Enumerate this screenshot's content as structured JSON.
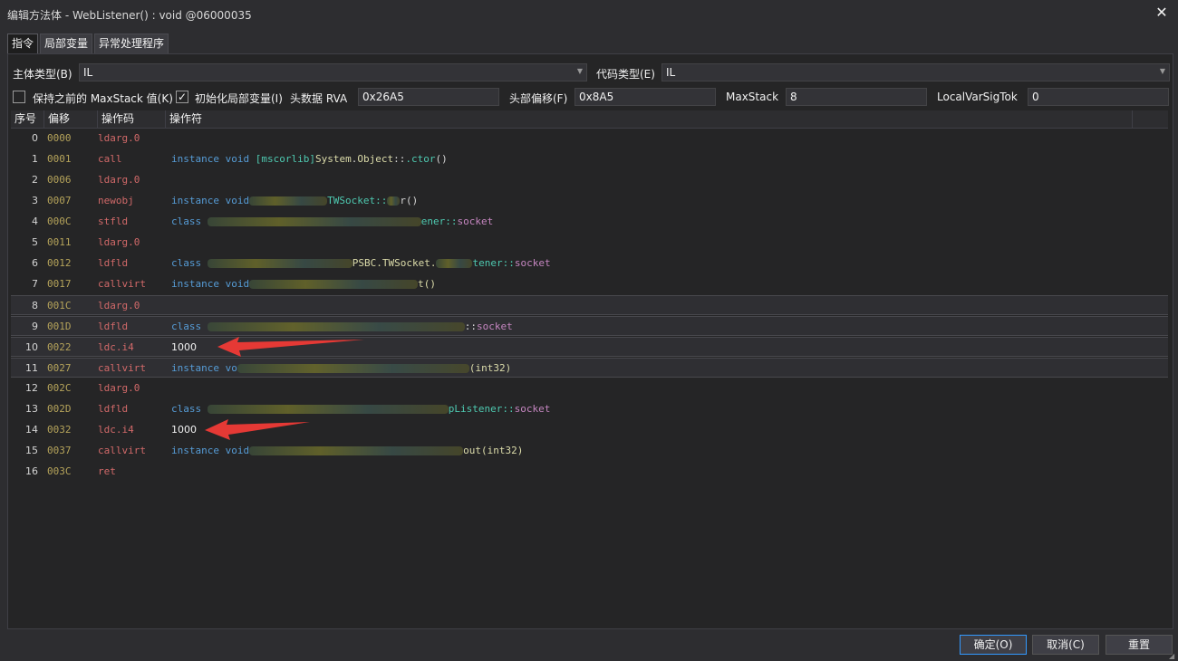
{
  "window": {
    "title": "编辑方法体 - WebListener() : void @06000035",
    "close": "✕"
  },
  "tabs": [
    "指令",
    "局部变量",
    "异常处理程序"
  ],
  "header": {
    "body_type_label": "主体类型(B)",
    "body_type_value": "IL",
    "code_type_label": "代码类型(E)",
    "code_type_value": "IL",
    "keep_maxstack_label": "保持之前的 MaxStack 值(K)",
    "keep_maxstack_checked": false,
    "init_locals_label": "初始化局部变量(I)",
    "init_locals_checked": true,
    "header_rva_label": "头数据 RVA",
    "header_rva_value": "0x26A5",
    "header_offset_label": "头部偏移(F)",
    "header_offset_value": "0x8A5",
    "maxstack_label": "MaxStack",
    "maxstack_value": "8",
    "localvarsig_label": "LocalVarSigTok",
    "localvarsig_value": "0"
  },
  "grid": {
    "columns": [
      "序号",
      "偏移",
      "操作码",
      "操作符"
    ],
    "rows": [
      {
        "idx": "0",
        "off": "0000",
        "op": "ldarg.0"
      },
      {
        "idx": "1",
        "off": "0001",
        "op": "call",
        "a": [
          "instance void ",
          "[mscorlib]",
          "System",
          ".",
          "Object",
          "::",
          ".ctor",
          "()"
        ]
      },
      {
        "idx": "2",
        "off": "0006",
        "op": "ldarg.0"
      },
      {
        "idx": "3",
        "off": "0007",
        "op": "newobj",
        "a": [
          "instance void",
          "TWSocket::",
          "r()"
        ]
      },
      {
        "idx": "4",
        "off": "000C",
        "op": "stfld",
        "a": [
          "class",
          "ener::",
          "socket"
        ]
      },
      {
        "idx": "5",
        "off": "0011",
        "op": "ldarg.0"
      },
      {
        "idx": "6",
        "off": "0012",
        "op": "ldfld",
        "a": [
          "class",
          "PSBC.TWSocket.",
          "tener::",
          "socket"
        ]
      },
      {
        "idx": "7",
        "off": "0017",
        "op": "callvirt",
        "a": [
          "instance void",
          "t()"
        ]
      },
      {
        "idx": "8",
        "off": "001C",
        "op": "ldarg.0"
      },
      {
        "idx": "9",
        "off": "001D",
        "op": "ldfld",
        "a": [
          "class",
          "::",
          "socket"
        ]
      },
      {
        "idx": "10",
        "off": "0022",
        "op": "ldc.i4",
        "a": [
          "1000"
        ]
      },
      {
        "idx": "11",
        "off": "0027",
        "op": "callvirt",
        "a": [
          "instance vo",
          "(int32)"
        ]
      },
      {
        "idx": "12",
        "off": "002C",
        "op": "ldarg.0"
      },
      {
        "idx": "13",
        "off": "002D",
        "op": "ldfld",
        "a": [
          "class",
          "pListener::",
          "socket"
        ]
      },
      {
        "idx": "14",
        "off": "0032",
        "op": "ldc.i4",
        "a": [
          "1000"
        ]
      },
      {
        "idx": "15",
        "off": "0037",
        "op": "callvirt",
        "a": [
          "instance void",
          "out(int32)"
        ]
      },
      {
        "idx": "16",
        "off": "003C",
        "op": "ret"
      }
    ]
  },
  "buttons": {
    "ok": "确定(O)",
    "cancel": "取消(C)",
    "reset": "重置"
  },
  "colors": {
    "annotation_arrow": "#e53935",
    "keyword": "#569cd6",
    "opcode": "#d16969",
    "offset": "#b5a35a"
  }
}
